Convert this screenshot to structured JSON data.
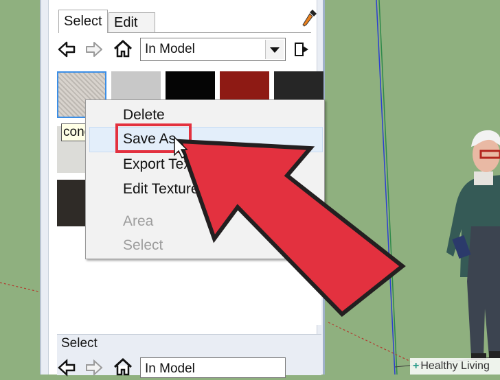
{
  "materials_panel": {
    "tabs": [
      {
        "label": "Select"
      },
      {
        "label": "Edit"
      }
    ],
    "collection": "In Model",
    "tooltip": "conc"
  },
  "context_menu": {
    "items": [
      {
        "label": "Delete",
        "enabled": true
      },
      {
        "label": "Save As...",
        "enabled": true,
        "highlighted": true
      },
      {
        "label": "Export Texture Image...",
        "enabled": true
      },
      {
        "label": "Edit Texture Image...",
        "enabled": true
      },
      {
        "label": "Area",
        "enabled": false
      },
      {
        "label": "Select",
        "enabled": false
      }
    ],
    "visible_labels": {
      "delete": "Delete",
      "save_as": "Save As",
      "export": "Export Text",
      "edit_texture": "Edit Texture Im",
      "area": "Area",
      "select": "Select"
    }
  },
  "lower_pane": {
    "title": "Select",
    "collection": "In Model"
  },
  "watermark": {
    "plus": "+",
    "brand": "Healthy Living"
  },
  "colors": {
    "background": "#8fb07f",
    "callout_arrow": "#e3313f",
    "menu_highlight": "#e3eefa",
    "swatch_colors": [
      "#cfcac4",
      "#c8c8c8",
      "#050505",
      "#8e1a14",
      "#262626",
      "#dcdcd8",
      "#ebebeb",
      "#2f2b27"
    ]
  }
}
